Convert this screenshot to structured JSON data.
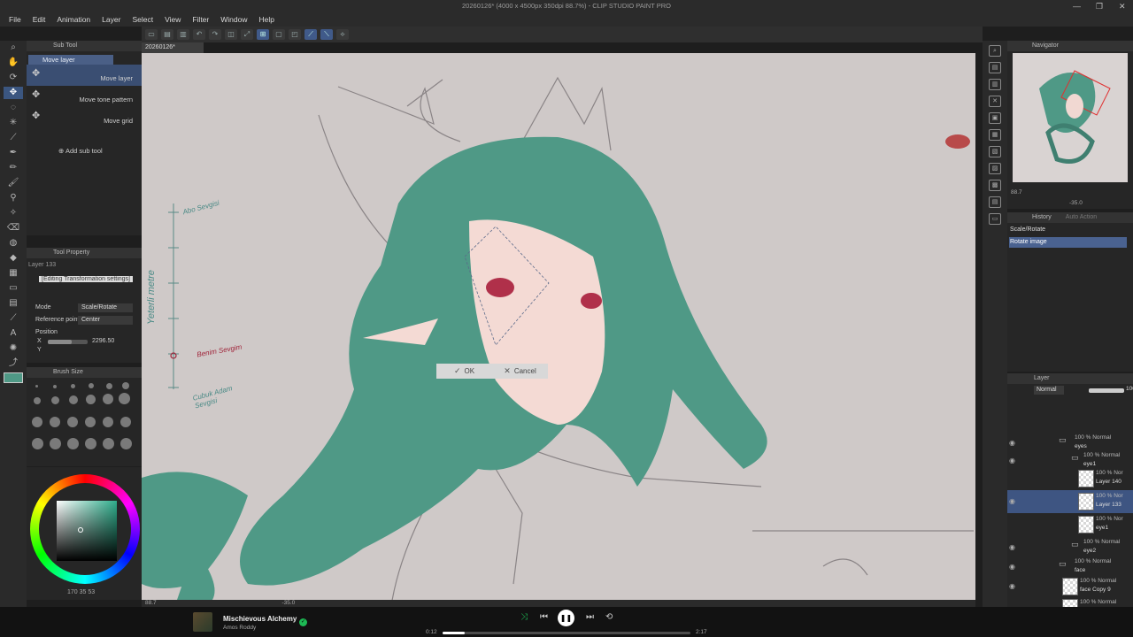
{
  "window": {
    "title": "20260126* (4000 x 4500px 350dpi 88.7%) - CLIP STUDIO PAINT PRO",
    "menus": [
      "File",
      "Edit",
      "Animation",
      "Layer",
      "Select",
      "View",
      "Filter",
      "Window",
      "Help"
    ]
  },
  "canvas": {
    "tab_label": "20260126*",
    "zoom": "88.7",
    "angle": "-35.0",
    "transform_ok": "OK",
    "transform_cancel": "Cancel",
    "annotations": {
      "top": "Abo Sevgisi",
      "vertical": "Yeterli metre",
      "middle": "Benim Sevgim",
      "bottom": "Cubuk Adam Sevgisi"
    },
    "hair_color": "#4f9986",
    "skin_color": "#f4dad4",
    "bg_color": "#cfc9c8",
    "eye_color": "#b0304a"
  },
  "subtool": {
    "panel_title": "Sub Tool",
    "group_label": "Move layer",
    "items": [
      {
        "label": "Move layer",
        "selected": true
      },
      {
        "label": "Move tone pattern",
        "selected": false
      },
      {
        "label": "Move grid",
        "selected": false
      }
    ],
    "add_label": "Add sub tool"
  },
  "tool_property": {
    "panel_title": "Tool Property",
    "layer_label": "Layer 133",
    "editing_label": "[Editing Transformation settings]",
    "mode_label": "Mode",
    "mode_value": "Scale/Rotate",
    "refpoint_label": "Reference point",
    "refpoint_value": "Center",
    "position_label": "Position",
    "x_label": "X",
    "x_value": "2296.50",
    "y_label": "Y"
  },
  "brush_size": {
    "panel_title": "Brush Size"
  },
  "color": {
    "main": "#4f9986",
    "status": "170 35 53"
  },
  "navigator": {
    "panel_title": "Navigator",
    "zoom": "88.7",
    "angle": "-35.0"
  },
  "history": {
    "panel_title": "History",
    "tab2": "Auto Action",
    "items": [
      {
        "label": "Scale/Rotate",
        "selected": false
      },
      {
        "label": "Rotate image",
        "selected": true
      }
    ]
  },
  "layers": {
    "panel_title": "Layer",
    "blend_mode": "Normal",
    "opacity": "100",
    "rows": [
      {
        "mode": "100 % Normal",
        "name": "eyes",
        "type": "folder",
        "selected": false
      },
      {
        "mode": "100 % Normal",
        "name": "eye1",
        "type": "folder",
        "selected": false
      },
      {
        "mode": "100 % Nor",
        "name": "Layer 140",
        "type": "layer",
        "selected": false
      },
      {
        "mode": "100 % Nor",
        "name": "Layer 133",
        "type": "layer",
        "selected": true
      },
      {
        "mode": "100 % Nor",
        "name": "eye1",
        "type": "layer",
        "selected": false
      },
      {
        "mode": "100 % Normal",
        "name": "eye2",
        "type": "folder",
        "selected": false
      },
      {
        "mode": "100 % Normal",
        "name": "face",
        "type": "folder",
        "selected": false
      },
      {
        "mode": "100 % Normal",
        "name": "face Copy 9",
        "type": "layer",
        "selected": false
      },
      {
        "mode": "100 % Normal",
        "name": "",
        "type": "layer",
        "selected": false
      }
    ]
  },
  "player": {
    "track": "Mischievous Alchemy",
    "artist": "Amos Roddy",
    "time_current": "0:12",
    "time_total": "2:17",
    "progress": 0.09
  }
}
